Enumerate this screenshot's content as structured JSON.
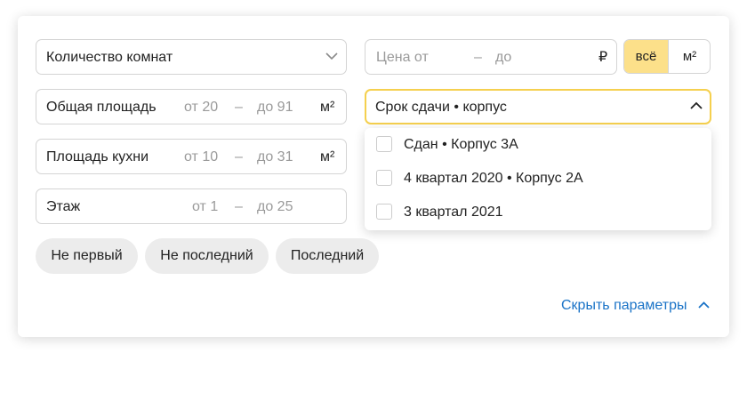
{
  "filters": {
    "rooms": {
      "label": "Количество комнат"
    },
    "price": {
      "from_placeholder": "Цена от",
      "dash": "–",
      "to_placeholder": "до",
      "currency": "₽"
    },
    "price_mode": {
      "all": "всё",
      "per_m2": "м²",
      "selected": "всё"
    },
    "total_area": {
      "label": "Общая площадь",
      "from_placeholder": "от 20",
      "dash": "–",
      "to_placeholder": "до 91",
      "unit": "м²"
    },
    "kitchen_area": {
      "label": "Площадь кухни",
      "from_placeholder": "от 10",
      "dash": "–",
      "to_placeholder": "до 31",
      "unit": "м²"
    },
    "floor": {
      "label": "Этаж",
      "from_placeholder": "от 1",
      "dash": "–",
      "to_placeholder": "до 25"
    },
    "deadline": {
      "label": "Срок сдачи • корпус",
      "options": [
        {
          "label": "Сдан • Корпус 3А",
          "checked": false
        },
        {
          "label": "4 квартал 2020 • Корпус 2А",
          "checked": false
        },
        {
          "label": "3 квартал 2021",
          "checked": false
        }
      ]
    },
    "floor_chips": [
      "Не первый",
      "Не последний",
      "Последний"
    ],
    "hide_link": "Скрыть параметры"
  },
  "colors": {
    "accent_yellow": "#fce08a",
    "focus_border": "#f5d04e",
    "link_blue": "#1a73c7"
  },
  "icons": {
    "dropdown_closed": "chevron-down-icon",
    "dropdown_open": "chevron-up-icon",
    "hide": "chevron-up-icon"
  }
}
